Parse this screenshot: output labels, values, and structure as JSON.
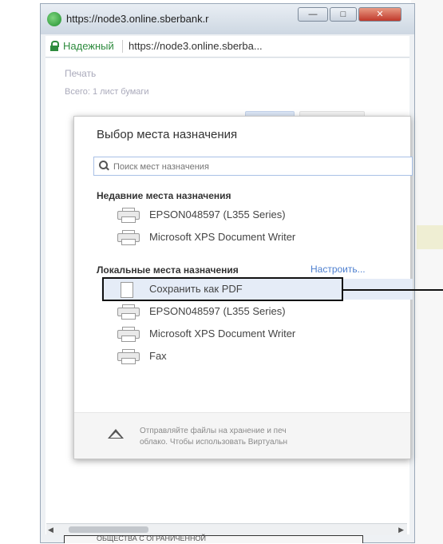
{
  "browser": {
    "title": "https://node3.online.sberbank.r",
    "security_label": "Надежный",
    "url": "https://node3.online.sberba..."
  },
  "background": {
    "print_title": "Печать",
    "print_total": "Всего: 1 лист бумаги"
  },
  "dialog": {
    "title": "Выбор места назначения",
    "search_placeholder": "Поиск мест назначения",
    "recent_header": "Недавние места назначения",
    "recent_items": [
      {
        "label": "EPSON048597 (L355 Series)",
        "icon": "printer-icon"
      },
      {
        "label": "Microsoft XPS Document Writer",
        "icon": "printer-icon"
      }
    ],
    "local_header": "Локальные места назначения",
    "manage_link": "Настроить...",
    "local_items": [
      {
        "label": "Сохранить как PDF",
        "icon": "pdf-document-icon"
      },
      {
        "label": "EPSON048597 (L355 Series)",
        "icon": "printer-icon"
      },
      {
        "label": "Microsoft XPS Document Writer",
        "icon": "printer-icon"
      },
      {
        "label": "Fax",
        "icon": "printer-icon"
      }
    ],
    "footer_line1": "Отправляйте файлы на хранение и печ",
    "footer_line2": "облако. Чтобы использовать Виртуальн"
  },
  "bottom_button": "ОБЩЕСТВА С ОГРАНИЧЕННОЙ"
}
